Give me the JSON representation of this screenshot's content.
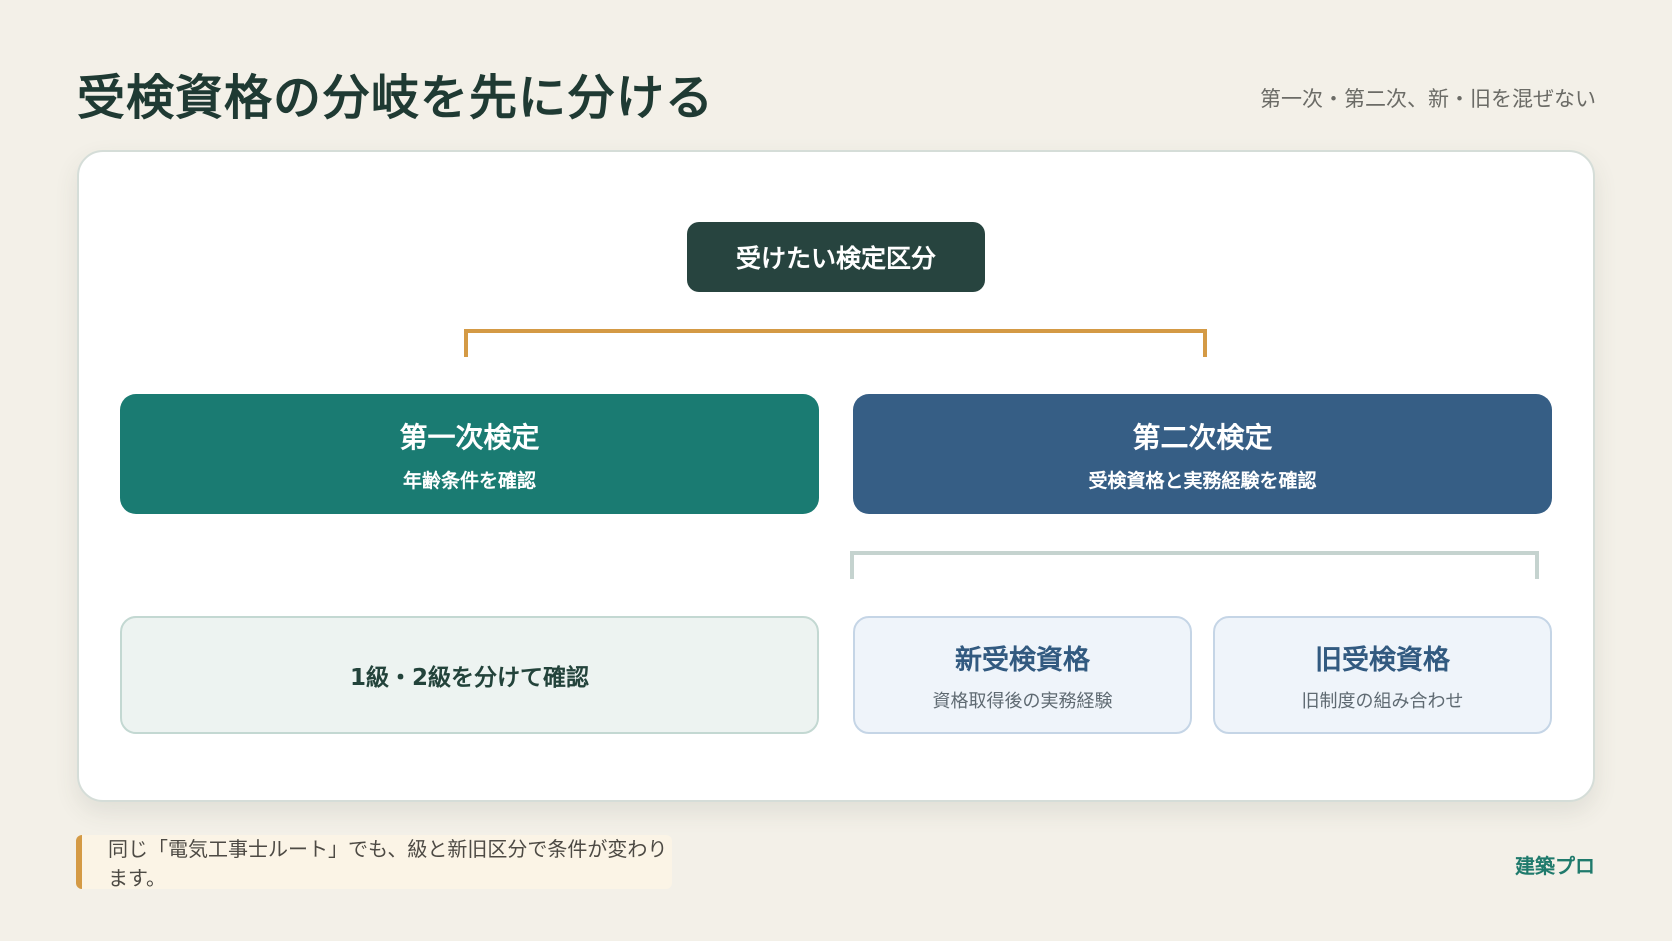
{
  "header": {
    "title": "受検資格の分岐を先に分ける",
    "subtitle": "第一次・第二次、新・旧を混ぜない"
  },
  "diagram": {
    "root": "受けたい検定区分",
    "first": {
      "title": "第一次検定",
      "subtitle": "年齢条件を確認"
    },
    "second": {
      "title": "第二次検定",
      "subtitle": "受検資格と実務経験を確認"
    },
    "first_leaf": "1級・2級を分けて確認",
    "new": {
      "title": "新受検資格",
      "subtitle": "資格取得後の実務経験"
    },
    "old": {
      "title": "旧受検資格",
      "subtitle": "旧制度の組み合わせ"
    }
  },
  "footer": {
    "note": "同じ「電気工事士ルート」でも、級と新旧区分で条件が変わります。",
    "brand": "建築プロ"
  },
  "colors": {
    "background": "#f3f0e8",
    "root": "#27443f",
    "first": "#1a7b72",
    "second": "#365e85",
    "accent": "#d49a45"
  }
}
